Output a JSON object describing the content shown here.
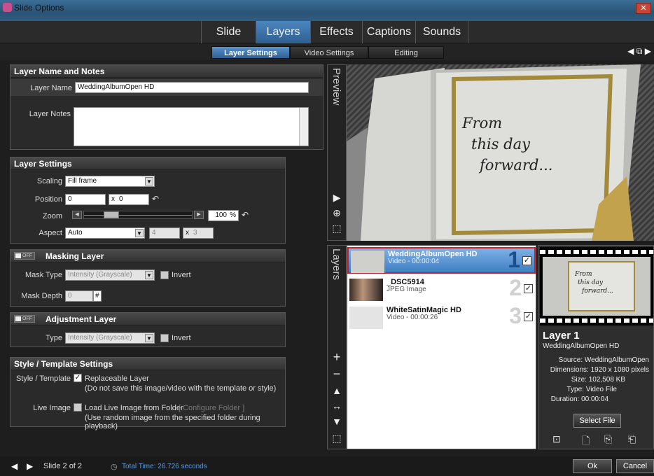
{
  "window": {
    "title": "Slide Options",
    "close_label": "✕"
  },
  "main_tabs": [
    {
      "label": "Slide"
    },
    {
      "label": "Layers",
      "active": true
    },
    {
      "label": "Effects"
    },
    {
      "label": "Captions"
    },
    {
      "label": "Sounds"
    }
  ],
  "sub_tabs": [
    {
      "label": "Layer Settings",
      "active": true
    },
    {
      "label": "Video Settings"
    },
    {
      "label": "Editing"
    }
  ],
  "name_notes": {
    "header": "Layer Name and Notes",
    "name_label": "Layer Name",
    "name_value": "WeddingAlbumOpen HD",
    "notes_label": "Layer Notes",
    "notes_value": ""
  },
  "layer_settings": {
    "header": "Layer Settings",
    "scaling_label": "Scaling",
    "scaling_value": "Fill frame",
    "position_label": "Position",
    "pos_x": "0",
    "pos_y": "0",
    "zoom_label": "Zoom",
    "zoom_value": "100",
    "zoom_unit": "%",
    "aspect_label": "Aspect",
    "aspect_value": "Auto",
    "aspect_w": "4",
    "aspect_h": "3",
    "x_sep": "x"
  },
  "masking": {
    "toggle": "OFF",
    "header": "Masking Layer",
    "mask_type_label": "Mask Type",
    "mask_type_value": "Intensity (Grayscale)",
    "invert_label": "Invert",
    "mask_depth_label": "Mask Depth",
    "mask_depth_value": "0",
    "depth_suffix": "#"
  },
  "adjustment": {
    "toggle": "OFF",
    "header": "Adjustment Layer",
    "type_label": "Type",
    "type_value": "Intensity (Grayscale)",
    "invert_label": "Invert"
  },
  "style": {
    "header": "Style / Template Settings",
    "st_label": "Style / Template",
    "replaceable_label": "Replaceable Layer",
    "replaceable_note": "(Do not save this image/video with the template or style)",
    "live_label": "Live Image",
    "live_cb_label": "Load Live Image from Folder",
    "configure_label": "[ Configure Folder ]",
    "live_note": "(Use random image from the specified folder during playback)"
  },
  "preview": {
    "label": "Preview",
    "line1": "From",
    "line2": "this day",
    "line3": "forward..."
  },
  "layers_panel": {
    "label": "Layers",
    "rows": [
      {
        "name": "WeddingAlbumOpen HD",
        "sub": "Video - 00:00:04",
        "num": "1",
        "selected": true
      },
      {
        "name": "_DSC5914",
        "sub": "JPEG Image",
        "num": "2",
        "selected": false
      },
      {
        "name": "WhiteSatinMagic HD",
        "sub": "Video - 00:00:26",
        "num": "3",
        "selected": false
      }
    ]
  },
  "layer_info": {
    "title": "Layer 1",
    "subtitle": "WeddingAlbumOpen HD",
    "source": "Source: WeddingAlbumOpen",
    "dimensions": "Dimensions: 1920 x 1080 pixels",
    "size": "Size: 102,508 KB",
    "type": "Type: Video File",
    "duration": "Duration: 00:00:04",
    "select_file": "Select File",
    "thumb_line1": "From",
    "thumb_line2": "this day",
    "thumb_line3": "forward..."
  },
  "status": {
    "slide": "Slide 2 of 2",
    "total_time": "Total Time: 26.726 seconds",
    "ok": "Ok",
    "cancel": "Cancel"
  },
  "colors": {
    "accent": "#3f7ec2",
    "selection_border": "#c0262d",
    "titlebar": "#2a5478"
  }
}
